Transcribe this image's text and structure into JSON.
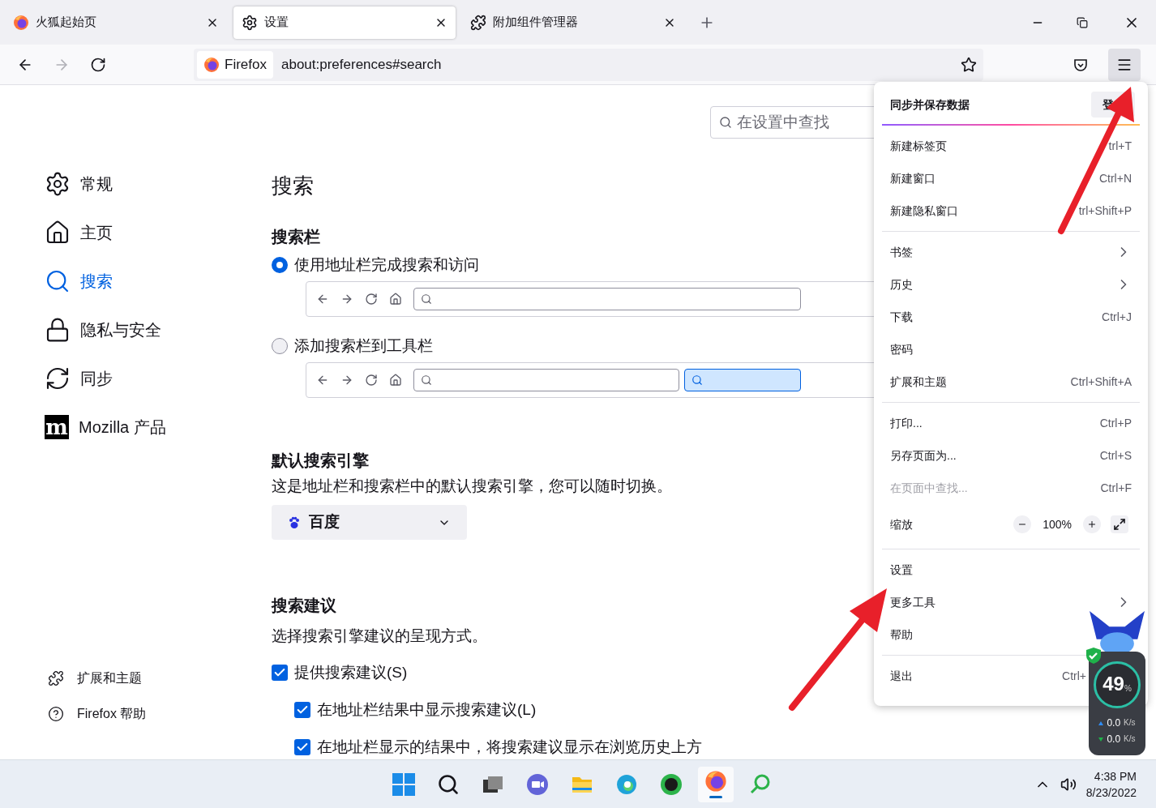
{
  "tabs": [
    {
      "title": "火狐起始页",
      "selected": false
    },
    {
      "title": "设置",
      "selected": true
    },
    {
      "title": "附加组件管理器",
      "selected": false
    }
  ],
  "address_bar": {
    "identity": "Firefox",
    "url": "about:preferences#search"
  },
  "settings_search": {
    "placeholder": "在设置中查找"
  },
  "sidebar": {
    "items": [
      {
        "label": "常规",
        "selected": false
      },
      {
        "label": "主页",
        "selected": false
      },
      {
        "label": "搜索",
        "selected": true
      },
      {
        "label": "隐私与安全",
        "selected": false
      },
      {
        "label": "同步",
        "selected": false
      },
      {
        "label": "Mozilla 产品",
        "logo_text": "m",
        "selected": false
      }
    ],
    "footer_links": [
      {
        "label": "扩展和主题"
      },
      {
        "label": "Firefox 帮助"
      }
    ]
  },
  "page_title": "搜索",
  "search_bar_section": {
    "heading": "搜索栏",
    "options": [
      {
        "label": "使用地址栏完成搜索和访问",
        "kind": "unified",
        "selected": true
      },
      {
        "label": "添加搜索栏到工具栏",
        "kind": "separate",
        "selected": false
      }
    ]
  },
  "default_engine_section": {
    "heading": "默认搜索引擎",
    "description": "这是地址栏和搜索栏中的默认搜索引擎，您可以随时切换。",
    "engine": "百度"
  },
  "suggestions_section": {
    "heading": "搜索建议",
    "description": "选择搜索引擎建议的呈现方式。",
    "options": [
      {
        "label": "提供搜索建议(S)",
        "checked": true,
        "children": [
          {
            "label": "在地址栏结果中显示搜索建议(L)",
            "checked": true
          },
          {
            "label": "在地址栏显示的结果中，将搜索建议显示在浏览历史上方",
            "checked": true
          }
        ]
      }
    ]
  },
  "app_menu": {
    "header": {
      "title": "同步并保存数据",
      "button": "登"
    },
    "sections": [
      [
        {
          "kind": "item",
          "label": "新建标签页",
          "shortcut": "trl+T",
          "disabled": false
        },
        {
          "kind": "item",
          "label": "新建窗口",
          "shortcut": "Ctrl+N",
          "disabled": false
        },
        {
          "kind": "item",
          "label": "新建隐私窗口",
          "shortcut": "trl+Shift+P",
          "disabled": false
        }
      ],
      [
        {
          "kind": "submenu",
          "label": "书签",
          "disabled": false
        },
        {
          "kind": "submenu",
          "label": "历史",
          "disabled": false
        },
        {
          "kind": "item",
          "label": "下载",
          "shortcut": "Ctrl+J",
          "disabled": false
        },
        {
          "kind": "item",
          "label": "密码",
          "disabled": false
        },
        {
          "kind": "item",
          "label": "扩展和主题",
          "shortcut": "Ctrl+Shift+A",
          "disabled": false
        }
      ],
      [
        {
          "kind": "item",
          "label": "打印...",
          "shortcut": "Ctrl+P",
          "disabled": false
        },
        {
          "kind": "item",
          "label": "另存页面为...",
          "shortcut": "Ctrl+S",
          "disabled": false
        },
        {
          "kind": "item",
          "label": "在页面中查找...",
          "shortcut": "Ctrl+F",
          "disabled": true
        },
        {
          "kind": "zoom",
          "label": "缩放",
          "value": "100%",
          "disabled": false
        }
      ],
      [
        {
          "kind": "item",
          "label": "设置",
          "disabled": false
        },
        {
          "kind": "submenu",
          "label": "更多工具",
          "disabled": false
        },
        {
          "kind": "item",
          "label": "帮助",
          "disabled": false
        }
      ],
      [
        {
          "kind": "item",
          "label": "退出",
          "shortcut": "Ctrl+",
          "disabled": false
        }
      ]
    ]
  },
  "speed_widget": {
    "percent": "49",
    "percent_unit": "%",
    "upload": "0.0",
    "upload_unit": "K/s",
    "download": "0.0",
    "download_unit": "K/s"
  },
  "taskbar": {
    "time": "4:38 PM",
    "date": "8/23/2022"
  }
}
